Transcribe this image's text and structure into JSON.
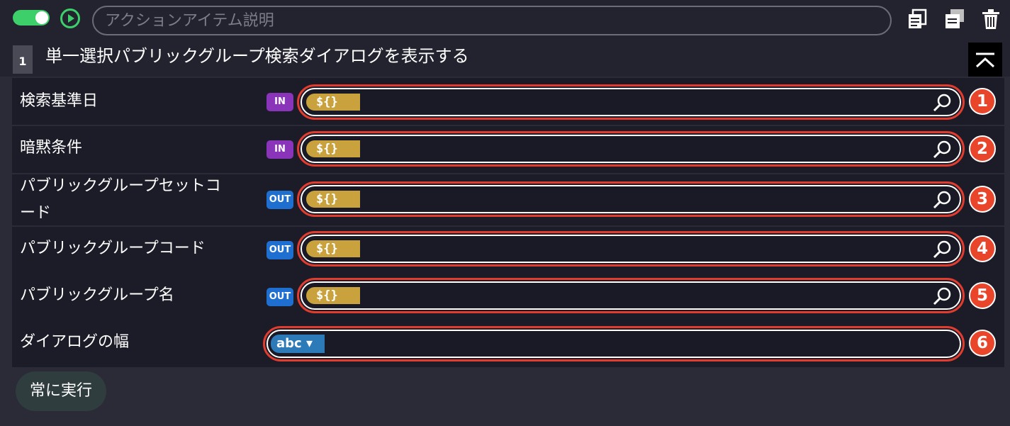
{
  "toolbar": {
    "toggle_on": true,
    "description_placeholder": "アクションアイテム説明",
    "icons": [
      "toggle-switch",
      "play-icon",
      "copy-icon",
      "paste-icon",
      "trash-icon"
    ]
  },
  "item": {
    "number": "1",
    "title": "単一選択パブリックグループ検索ダイアログを表示する"
  },
  "params": [
    {
      "label": "検索基準日",
      "io": "IN",
      "tag": "${}",
      "callout": "1"
    },
    {
      "label": "暗黙条件",
      "io": "IN",
      "tag": "${}",
      "callout": "2"
    },
    {
      "label": "パブリックグループセットコ",
      "label2": "ード",
      "io": "OUT",
      "tag": "${}",
      "callout": "3"
    },
    {
      "label": "パブリックグループコード",
      "io": "OUT",
      "tag": "${}",
      "callout": "4"
    },
    {
      "label": "パブリックグループ名",
      "io": "OUT",
      "tag": "${}",
      "callout": "5"
    },
    {
      "label": "ダイアログの幅",
      "tag": "abc ▾",
      "callout": "6"
    }
  ],
  "footer": {
    "always_run_label": "常に実行"
  },
  "colors": {
    "background": "#2b2b38",
    "row": "#1c1c28",
    "in_badge": "#8a34b9",
    "out_badge": "#1e6fd0",
    "variable_tag": "#c9a23e",
    "type_tag": "#2d7ab8",
    "highlight": "#e23c2e",
    "toggle_on": "#3dd06a"
  }
}
